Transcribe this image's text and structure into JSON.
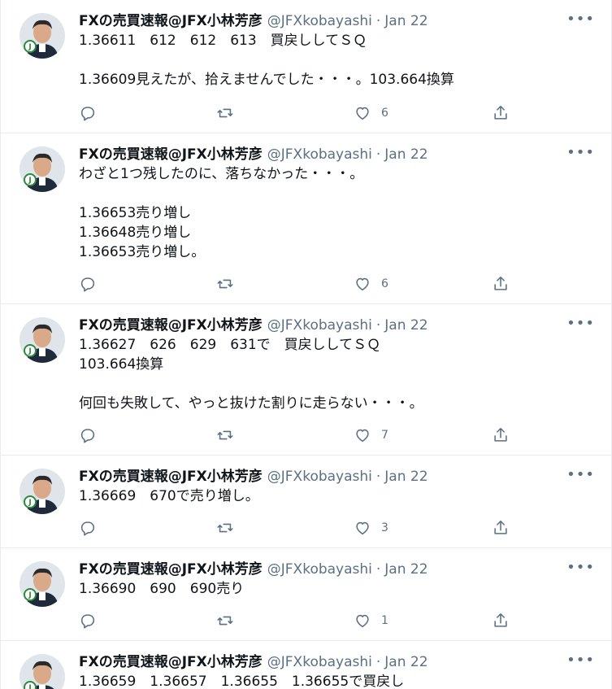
{
  "author": {
    "name": "FXの売買速報@JFX小林芳彦",
    "handle": "@JFXkobayashi",
    "sep": "·"
  },
  "more_label": "•••",
  "tweets": [
    {
      "date": "Jan 22",
      "text": "1.36611　612　612　613　買戻ししてＳＱ\n\n1.36609見えたが、拾えませんでした・・・。103.664換算",
      "likes": "6"
    },
    {
      "date": "Jan 22",
      "text": "わざと1つ残したのに、落ちなかった・・・。\n\n1.36653売り増し\n1.36648売り増し\n1.36653売り増し。",
      "likes": "6"
    },
    {
      "date": "Jan 22",
      "text": "1.36627　626　629　631で　買戻ししてＳＱ\n103.664換算\n\n何回も失敗して、やっと抜けた割りに走らない・・・。",
      "likes": "7"
    },
    {
      "date": "Jan 22",
      "text": "1.36669　670で売り増し。",
      "likes": "3"
    },
    {
      "date": "Jan 22",
      "text": "1.36690　690　690売り",
      "likes": "1"
    },
    {
      "date": "Jan 22",
      "text": "1.36659　1.36657　1.36655　1.36655で買戻し",
      "likes": ""
    }
  ]
}
